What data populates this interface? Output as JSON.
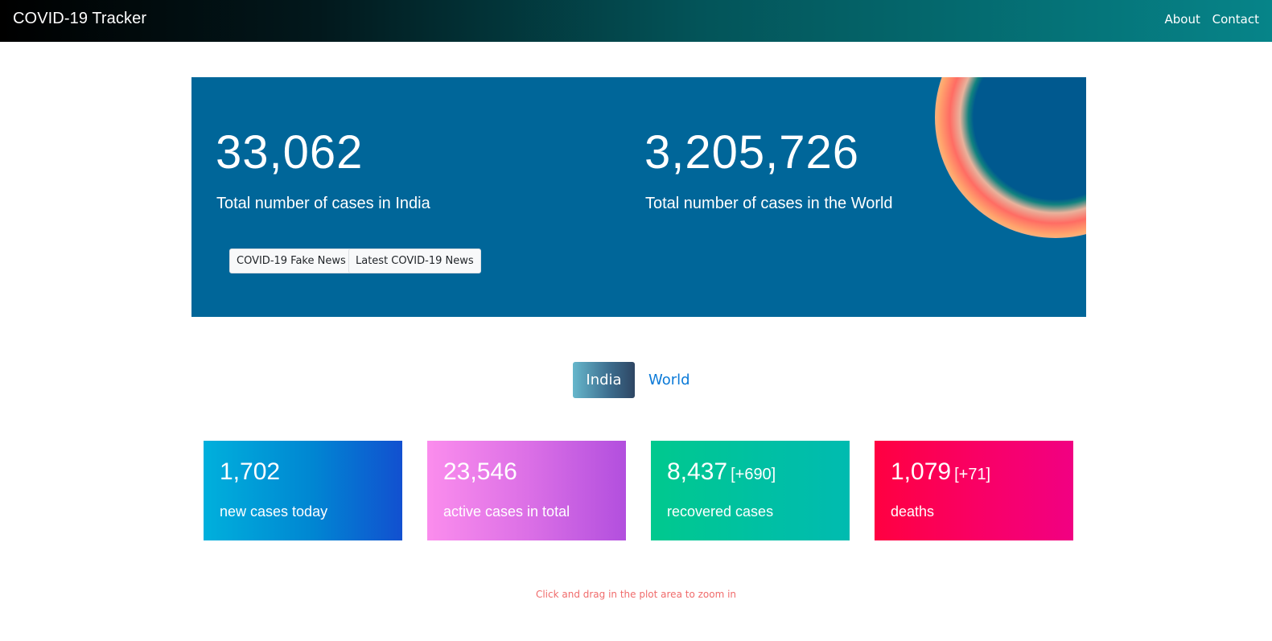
{
  "navbar": {
    "brand": "COVID-19 Tracker",
    "links": [
      "About",
      "Contact"
    ]
  },
  "hero": {
    "india": {
      "value": "33,062",
      "label": "Total number of cases in India"
    },
    "world": {
      "value": "3,205,726",
      "label": "Total number of cases in the World"
    },
    "buttons": [
      "COVID-19 Fake News",
      "Latest COVID-19 News"
    ]
  },
  "toggle": {
    "active": "India",
    "inactive": "World"
  },
  "cards": [
    {
      "value": "1,702",
      "delta": "",
      "label": "new cases today"
    },
    {
      "value": "23,546",
      "delta": "",
      "label": "active cases in total"
    },
    {
      "value": "8,437",
      "delta": "[+690]",
      "label": "recovered cases"
    },
    {
      "value": "1,079",
      "delta": "[+71]",
      "label": "deaths"
    }
  ],
  "colors": {
    "hero_bg": "#006699",
    "card_new": "#00b0dc",
    "card_active": "#f58ded",
    "card_recovered": "#00c98e",
    "card_deaths": "#ff0041"
  },
  "chart_hint": "Click and drag in the plot area to zoom in"
}
